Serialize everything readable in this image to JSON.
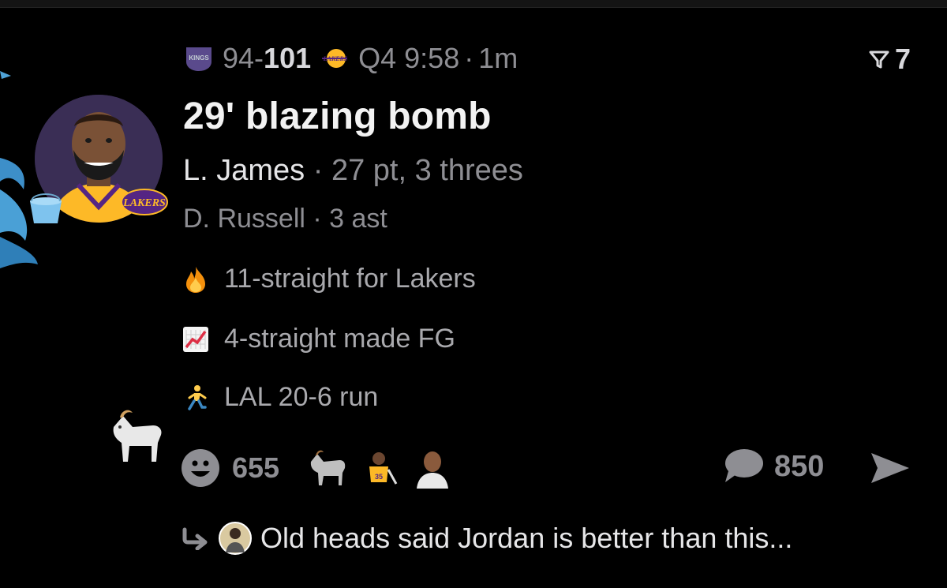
{
  "game": {
    "away_score": "94",
    "separator": "-",
    "home_score": "101",
    "clock": "Q4 9:58",
    "dot": "·",
    "age": "1m",
    "away_logo": "kings-logo-icon",
    "home_logo": "lakers-logo-icon"
  },
  "filter": {
    "icon": "filter-icon",
    "count": "7"
  },
  "play": {
    "title": "29' blazing bomb",
    "player": "L. James",
    "player_stats": "· 27 pt, 3 threes",
    "assist": "D. Russell · 3 ast"
  },
  "streaks": [
    {
      "icon": "fire-icon",
      "text": "11-straight for Lakers"
    },
    {
      "icon": "chart-increasing-icon",
      "text": "4-straight made FG"
    },
    {
      "icon": "runner-icon",
      "text": "LAL 20-6 run"
    }
  ],
  "reactions": {
    "icon": "smiley-icon",
    "count": "655"
  },
  "comments": {
    "icon": "comment-bubble-icon",
    "count": "850"
  },
  "reply": {
    "icon": "reply-arrow-icon",
    "text": "Old heads said Jordan is better than this..."
  },
  "colors": {
    "background": "#000000",
    "muted": "#8e8e93",
    "text": "#e6e6e8",
    "avatar_bg": "#3a2e55",
    "lakers_gold": "#fdb927",
    "lakers_purple": "#552583"
  }
}
